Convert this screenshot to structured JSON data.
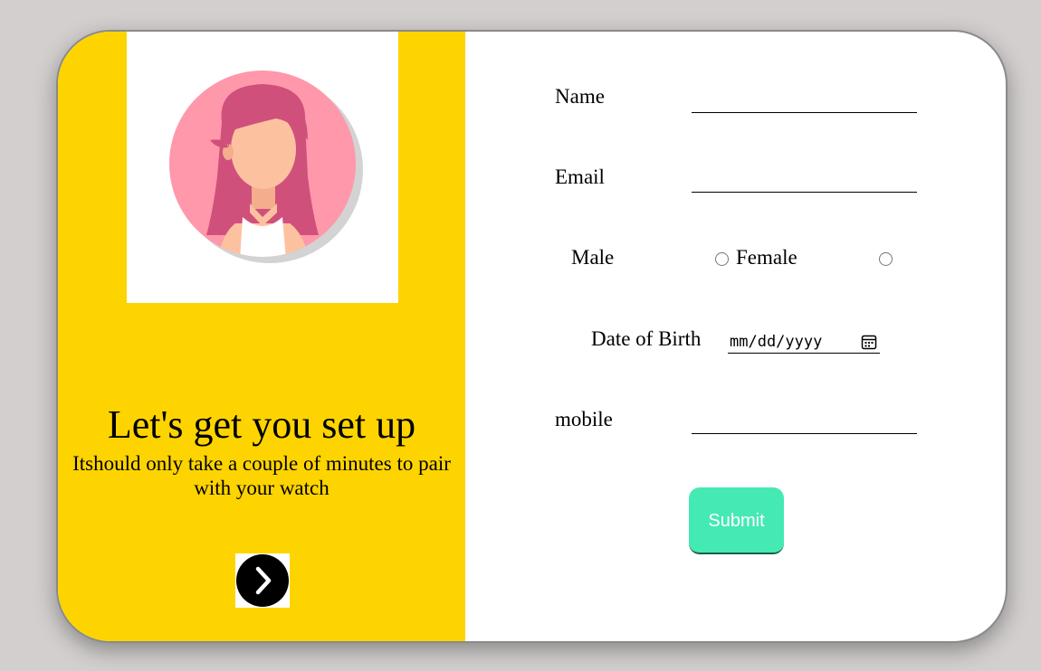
{
  "left_panel": {
    "headline": "Let's get you set up",
    "subtext": "Itshould only take a couple of minutes to pair with your watch",
    "next_icon": "chevron-right-icon"
  },
  "form": {
    "name_label": "Name",
    "name_value": "",
    "email_label": "Email",
    "email_value": "",
    "gender": {
      "male_label": "Male",
      "female_label": "Female",
      "selected": null
    },
    "dob_label": "Date of Birth",
    "dob_placeholder": "mm/dd/yyyy",
    "dob_icon": "calendar-icon",
    "mobile_label": "mobile",
    "mobile_value": "",
    "submit_label": "Submit"
  },
  "colors": {
    "left_bg": "#fed400",
    "submit_bg": "#45e9b4",
    "avatar_bg": "#ff98aa",
    "hair": "#d0507c"
  }
}
